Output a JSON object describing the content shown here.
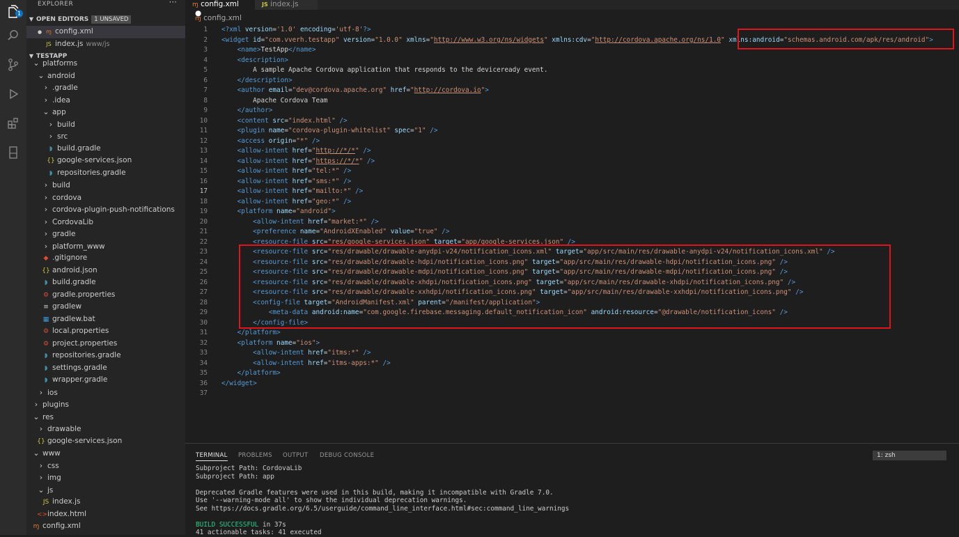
{
  "activity_bar": {
    "badge": "1"
  },
  "explorer": {
    "title": "EXPLORER",
    "more": "···",
    "open_editors": {
      "label": "OPEN EDITORS",
      "badge": "1 UNSAVED",
      "items": [
        {
          "name": "config.xml",
          "hint": "",
          "icon": "xml-icon"
        },
        {
          "name": "index.js",
          "hint": "www/js",
          "icon": "js-icon"
        }
      ]
    },
    "workspace": {
      "label": "TESTAPP"
    },
    "tree": [
      {
        "label": "platforms",
        "depth": 0,
        "kind": "folder-open",
        "icon": "chevron-down-icon"
      },
      {
        "label": "android",
        "depth": 1,
        "kind": "folder-open",
        "icon": "chevron-down-icon"
      },
      {
        "label": ".gradle",
        "depth": 2,
        "kind": "folder",
        "icon": "chevron-right-icon"
      },
      {
        "label": ".idea",
        "depth": 2,
        "kind": "folder",
        "icon": "chevron-right-icon"
      },
      {
        "label": "app",
        "depth": 2,
        "kind": "folder-open",
        "icon": "chevron-down-icon"
      },
      {
        "label": "build",
        "depth": 3,
        "kind": "folder",
        "icon": "chevron-right-icon"
      },
      {
        "label": "src",
        "depth": 3,
        "kind": "folder",
        "icon": "chevron-right-icon"
      },
      {
        "label": "build.gradle",
        "depth": 3,
        "kind": "file",
        "icon": "gradle-icon"
      },
      {
        "label": "google-services.json",
        "depth": 3,
        "kind": "file",
        "icon": "json-icon"
      },
      {
        "label": "repositories.gradle",
        "depth": 3,
        "kind": "file",
        "icon": "gradle-icon"
      },
      {
        "label": "build",
        "depth": 2,
        "kind": "folder",
        "icon": "chevron-right-icon"
      },
      {
        "label": "cordova",
        "depth": 2,
        "kind": "folder",
        "icon": "chevron-right-icon"
      },
      {
        "label": "cordova-plugin-push-notifications",
        "depth": 2,
        "kind": "folder",
        "icon": "chevron-right-icon"
      },
      {
        "label": "CordovaLib",
        "depth": 2,
        "kind": "folder",
        "icon": "chevron-right-icon"
      },
      {
        "label": "gradle",
        "depth": 2,
        "kind": "folder",
        "icon": "chevron-right-icon"
      },
      {
        "label": "platform_www",
        "depth": 2,
        "kind": "folder",
        "icon": "chevron-right-icon"
      },
      {
        "label": ".gitignore",
        "depth": 2,
        "kind": "file",
        "icon": "git-icon"
      },
      {
        "label": "android.json",
        "depth": 2,
        "kind": "file",
        "icon": "json-icon"
      },
      {
        "label": "build.gradle",
        "depth": 2,
        "kind": "file",
        "icon": "gradle-icon"
      },
      {
        "label": "gradle.properties",
        "depth": 2,
        "kind": "file",
        "icon": "properties-icon"
      },
      {
        "label": "gradlew",
        "depth": 2,
        "kind": "file",
        "icon": "lines-icon"
      },
      {
        "label": "gradlew.bat",
        "depth": 2,
        "kind": "file",
        "icon": "windows-icon"
      },
      {
        "label": "local.properties",
        "depth": 2,
        "kind": "file",
        "icon": "properties-icon"
      },
      {
        "label": "project.properties",
        "depth": 2,
        "kind": "file",
        "icon": "properties-icon"
      },
      {
        "label": "repositories.gradle",
        "depth": 2,
        "kind": "file",
        "icon": "gradle-icon"
      },
      {
        "label": "settings.gradle",
        "depth": 2,
        "kind": "file",
        "icon": "gradle-icon"
      },
      {
        "label": "wrapper.gradle",
        "depth": 2,
        "kind": "file",
        "icon": "gradle-icon"
      },
      {
        "label": "ios",
        "depth": 1,
        "kind": "folder",
        "icon": "chevron-right-icon"
      },
      {
        "label": "plugins",
        "depth": 0,
        "kind": "folder",
        "icon": "chevron-right-icon"
      },
      {
        "label": "res",
        "depth": 0,
        "kind": "folder-open",
        "icon": "chevron-down-icon"
      },
      {
        "label": "drawable",
        "depth": 1,
        "kind": "folder",
        "icon": "chevron-right-icon"
      },
      {
        "label": "google-services.json",
        "depth": 1,
        "kind": "file",
        "icon": "json-icon"
      },
      {
        "label": "www",
        "depth": 0,
        "kind": "folder-open",
        "icon": "chevron-down-icon"
      },
      {
        "label": "css",
        "depth": 1,
        "kind": "folder",
        "icon": "chevron-right-icon"
      },
      {
        "label": "img",
        "depth": 1,
        "kind": "folder",
        "icon": "chevron-right-icon"
      },
      {
        "label": "js",
        "depth": 1,
        "kind": "folder-open",
        "icon": "chevron-down-icon"
      },
      {
        "label": "index.js",
        "depth": 2,
        "kind": "file",
        "icon": "js-icon"
      },
      {
        "label": "index.html",
        "depth": 1,
        "kind": "file",
        "icon": "html-icon"
      },
      {
        "label": "config.xml",
        "depth": 0,
        "kind": "file",
        "icon": "xml-icon"
      }
    ]
  },
  "tabs": [
    {
      "label": "config.xml",
      "icon": "xml-icon",
      "modified": "●",
      "active": true
    },
    {
      "label": "index.js",
      "icon": "js-icon",
      "modified": "",
      "active": false
    }
  ],
  "breadcrumb": "config.xml",
  "editor": {
    "current_line": 17,
    "lines": [
      "<?xml version='1.0' encoding='utf-8'?>",
      "<widget id=\"com.vverh.testapp\" version=\"1.0.0\" xmlns=\"http://www.w3.org/ns/widgets\" xmlns:cdv=\"http://cordova.apache.org/ns/1.0\" xmlns:android=\"schemas.android.com/apk/res/android\">",
      "    <name>TestApp</name>",
      "    <description>",
      "        A sample Apache Cordova application that responds to the deviceready event.",
      "    </description>",
      "    <author email=\"dev@cordova.apache.org\" href=\"http://cordova.io\">",
      "        Apache Cordova Team",
      "    </author>",
      "    <content src=\"index.html\" />",
      "    <plugin name=\"cordova-plugin-whitelist\" spec=\"1\" />",
      "    <access origin=\"*\" />",
      "    <allow-intent href=\"http://*/*\" />",
      "    <allow-intent href=\"https://*/*\" />",
      "    <allow-intent href=\"tel:*\" />",
      "    <allow-intent href=\"sms:*\" />",
      "    <allow-intent href=\"mailto:*\" />",
      "    <allow-intent href=\"geo:*\" />",
      "    <platform name=\"android\">",
      "        <allow-intent href=\"market:*\" />",
      "        <preference name=\"AndroidXEnabled\" value=\"true\" />",
      "        <resource-file src=\"res/google-services.json\" target=\"app/google-services.json\" />",
      "        <resource-file src=\"res/drawable/drawable-anydpi-v24/notification_icons.xml\" target=\"app/src/main/res/drawable-anydpi-v24/notification_icons.xml\" />",
      "        <resource-file src=\"res/drawable/drawable-hdpi/notification_icons.png\" target=\"app/src/main/res/drawable-hdpi/notification_icons.png\" />",
      "        <resource-file src=\"res/drawable/drawable-mdpi/notification_icons.png\" target=\"app/src/main/res/drawable-mdpi/notification_icons.png\" />",
      "        <resource-file src=\"res/drawable/drawable-xhdpi/notification_icons.png\" target=\"app/src/main/res/drawable-xhdpi/notification_icons.png\" />",
      "        <resource-file src=\"res/drawable/drawable-xxhdpi/notification_icons.png\" target=\"app/src/main/res/drawable-xxhdpi/notification_icons.png\" />",
      "        <config-file target=\"AndroidManifest.xml\" parent=\"/manifest/application\">",
      "            <meta-data android:name=\"com.google.firebase.messaging.default_notification_icon\" android:resource=\"@drawable/notification_icons\" />",
      "        </config-file>",
      "    </platform>",
      "    <platform name=\"ios\">",
      "        <allow-intent href=\"itms:*\" />",
      "        <allow-intent href=\"itms-apps:*\" />",
      "    </platform>",
      "</widget>",
      ""
    ]
  },
  "panel": {
    "tabs": [
      "TERMINAL",
      "PROBLEMS",
      "OUTPUT",
      "DEBUG CONSOLE"
    ],
    "active_tab": "TERMINAL",
    "terminal_select": "1: zsh",
    "terminal_lines": [
      "Subproject Path: CordovaLib",
      "Subproject Path: app",
      "",
      "Deprecated Gradle features were used in this build, making it incompatible with Gradle 7.0.",
      "Use '--warning-mode all' to show the individual deprecation warnings.",
      "See https://docs.gradle.org/6.5/userguide/command_line_interface.html#sec:command_line_warnings",
      "",
      "BUILD SUCCESSFUL in 37s",
      "41 actionable tasks: 41 executed"
    ]
  },
  "colors": {
    "highlight_box": "#e0141b",
    "tag": "#569cd6",
    "attribute": "#9cdcfe",
    "string": "#ce9178",
    "success": "#23d18b"
  }
}
